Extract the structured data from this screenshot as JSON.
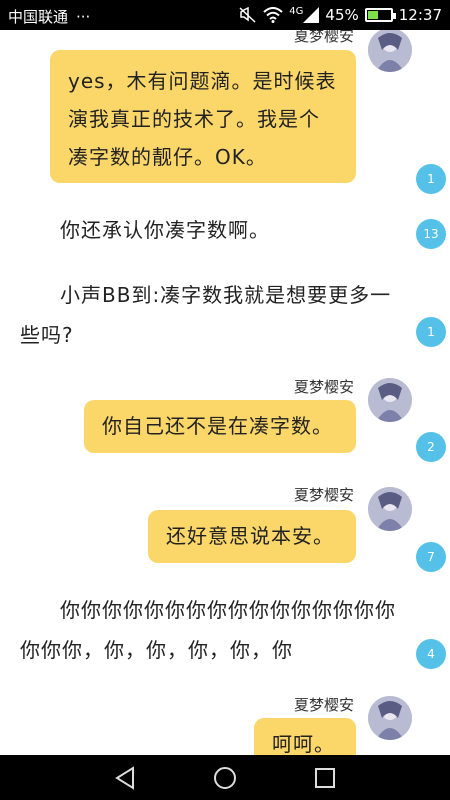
{
  "status_bar": {
    "carrier": "中国联通",
    "more": "···",
    "network": "4G",
    "battery": "45%",
    "battery_level": 0.45,
    "time": "12:37"
  },
  "chat": {
    "messages": [
      {
        "sender": "夏梦樱安",
        "text": "yes，木有问题滴。是时候表演我真正的技术了。我是个凑字数的靓仔。OK。",
        "count": "1"
      },
      {
        "text": "你还承认你凑字数啊。",
        "count": "13"
      },
      {
        "text": "小声BB到:凑字数我就是想要更多一些吗?",
        "count": "1"
      },
      {
        "sender": "夏梦樱安",
        "text": "你自己还不是在凑字数。",
        "count": "2"
      },
      {
        "sender": "夏梦樱安",
        "text": "还好意思说本安。",
        "count": "7"
      },
      {
        "text": "你你你你你你你你你你你你你你你你你你你，你，你，你，你，你",
        "count": "4"
      },
      {
        "sender": "夏梦樱安",
        "text": "呵呵。"
      }
    ]
  },
  "icons": {
    "mute": "mute-icon",
    "wifi": "wifi-icon",
    "signal": "signal-icon",
    "battery": "battery-icon",
    "back": "back-icon",
    "home": "home-icon",
    "recents": "recents-icon"
  },
  "colors": {
    "bubble": "#fbd769",
    "badge": "#55c1e8"
  }
}
